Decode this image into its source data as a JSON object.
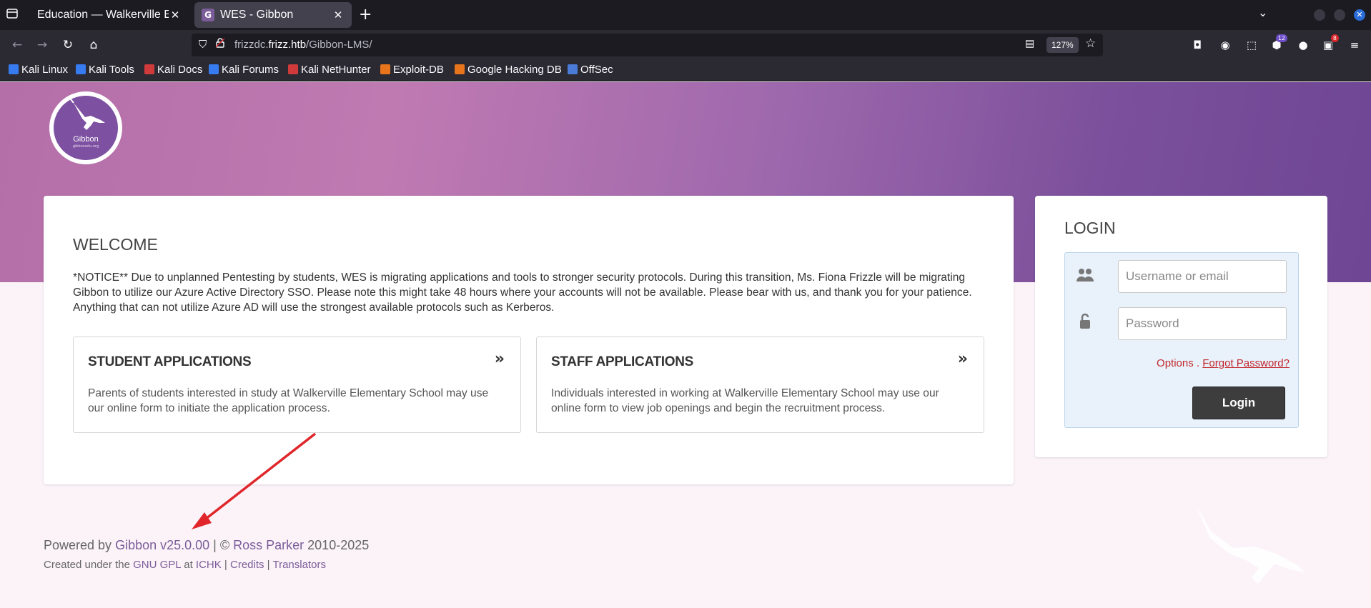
{
  "browser": {
    "tabs": [
      {
        "title": "Education — Walkerville Elementary School",
        "active": false
      },
      {
        "title": "WES - Gibbon",
        "active": true,
        "favicon_letter": "G"
      }
    ],
    "url_host_prefix": "frizzdc.",
    "url_host_main": "frizz.htb",
    "url_path": "/Gibbon-LMS/",
    "zoom": "127%",
    "badges": {
      "extensions": "12",
      "notifications": "8"
    },
    "bookmarks": [
      {
        "label": "Kali Linux",
        "icon_color": "#367bf0"
      },
      {
        "label": "Kali Tools",
        "icon_color": "#367bf0"
      },
      {
        "label": "Kali Docs",
        "icon_color": "#d03a3a"
      },
      {
        "label": "Kali Forums",
        "icon_color": "#367bf0"
      },
      {
        "label": "Kali NetHunter",
        "icon_color": "#d03a3a"
      },
      {
        "label": "Exploit-DB",
        "icon_color": "#e8741c"
      },
      {
        "label": "Google Hacking DB",
        "icon_color": "#e8741c"
      },
      {
        "label": "OffSec",
        "icon_color": "#4a7bd8"
      }
    ]
  },
  "logo": {
    "name": "Gibbon",
    "sub": "gibbonedu.org"
  },
  "welcome": {
    "title": "WELCOME",
    "notice": "*NOTICE** Due to unplanned Pentesting by students, WES is migrating applications and tools to stronger security protocols. During this transition, Ms. Fiona Frizzle will be migrating Gibbon to utilize our Azure Active Directory SSO. Please note this might take 48 hours where your accounts will not be available. Please bear with us, and thank you for your patience. Anything that can not utilize Azure AD will use the strongest available protocols such as Kerberos.",
    "student": {
      "title": "STUDENT APPLICATIONS",
      "desc": "Parents of students interested in study at Walkerville Elementary School may use our online form to initiate the application process."
    },
    "staff": {
      "title": "STAFF APPLICATIONS",
      "desc": "Individuals interested in working at Walkerville Elementary School may use our online form to view job openings and begin the recruitment process."
    }
  },
  "login": {
    "title": "LOGIN",
    "username_placeholder": "Username or email",
    "password_placeholder": "Password",
    "options": "Options",
    "forgot": "Forgot Password?",
    "button": "Login"
  },
  "footer": {
    "powered_by": "Powered by ",
    "gibbon_link": "Gibbon v25.0.00",
    "sep1": " | © ",
    "author": "Ross Parker",
    "years": " 2010-2025",
    "created_prefix": "Created under the ",
    "gpl": "GNU GPL",
    "at": " at ",
    "ichk": "ICHK",
    "sep2": " | ",
    "credits": "Credits",
    "translators": "Translators"
  },
  "colors": {
    "hero_start": "#b46ea8",
    "hero_end": "#6e4694",
    "link": "#7c5d9a",
    "error_link": "#c1272d",
    "annotation_arrow": "#e0262a"
  }
}
